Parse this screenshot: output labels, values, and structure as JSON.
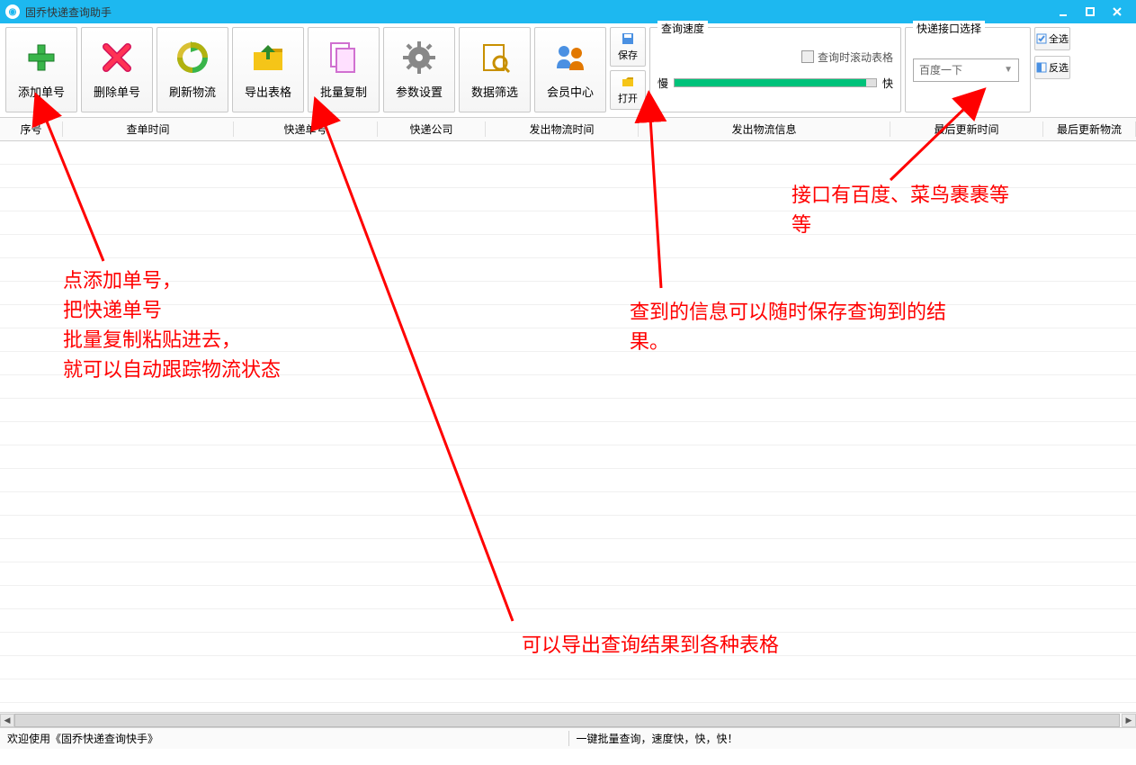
{
  "window": {
    "title": "固乔快递查询助手"
  },
  "toolbar": {
    "add": "添加单号",
    "delete": "删除单号",
    "refresh": "刷新物流",
    "export": "导出表格",
    "batch_copy": "批量复制",
    "params": "参数设置",
    "filter": "数据筛选",
    "member": "会员中心",
    "save": "保存",
    "open": "打开"
  },
  "speed": {
    "group_title": "查询速度",
    "scroll_label": "查询时滚动表格",
    "slow": "慢",
    "fast": "快"
  },
  "iface": {
    "group_title": "快递接口选择",
    "selected": "百度一下"
  },
  "select_all": "全选",
  "invert_sel": "反选",
  "columns": {
    "c0": "序号",
    "c1": "查单时间",
    "c2": "快递单号",
    "c3": "快递公司",
    "c4": "发出物流时间",
    "c5": "发出物流信息",
    "c6": "最后更新时间",
    "c7": "最后更新物流"
  },
  "status": {
    "left": "欢迎使用《固乔快递查询快手》",
    "right": "一键批量查询，速度快，快，快！"
  },
  "annotations": {
    "a1_l1": "点添加单号，",
    "a1_l2": "把快递单号",
    "a1_l3": "批量复制粘贴进去，",
    "a1_l4": "就可以自动跟踪物流状态",
    "a2_l1": "查到的信息可以随时保存查询到的结",
    "a2_l2": "果。",
    "a3_l1": "接口有百度、菜鸟裹裹等",
    "a3_l2": "等",
    "a4": "可以导出查询结果到各种表格"
  }
}
